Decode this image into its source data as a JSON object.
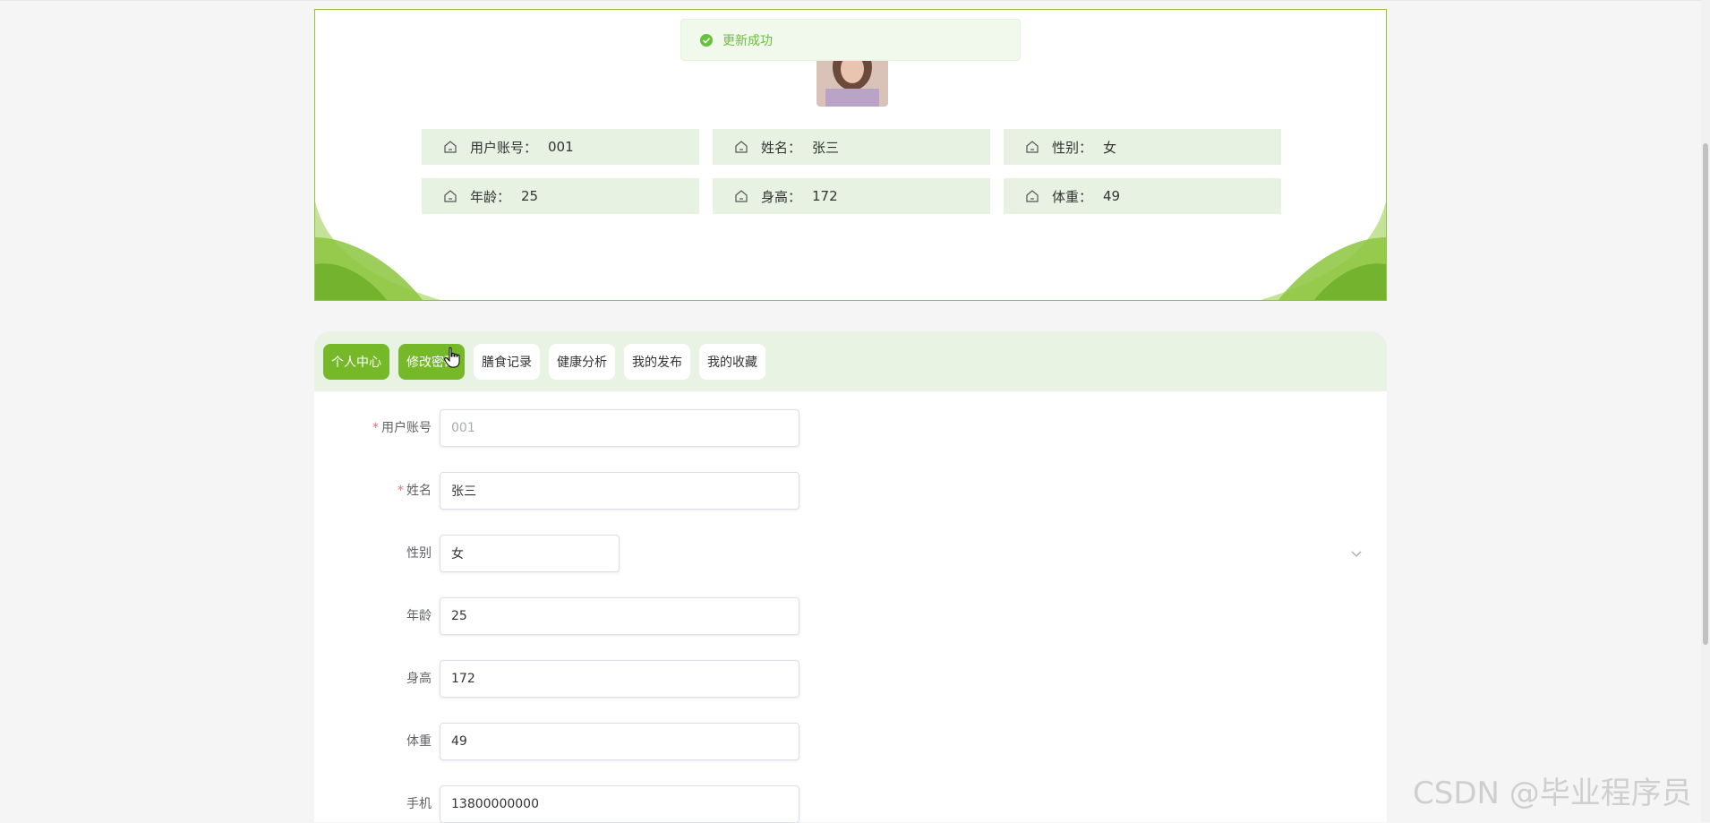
{
  "toast": {
    "message": "更新成功",
    "icon": "check-circle-icon",
    "color": "#67c23a"
  },
  "profile": {
    "avatar": "user-avatar-photo",
    "fields": [
      {
        "label": "用户账号：",
        "value": "001",
        "icon": "home-icon"
      },
      {
        "label": "姓名：",
        "value": "张三",
        "icon": "home-icon"
      },
      {
        "label": "性别：",
        "value": "女",
        "icon": "home-icon"
      },
      {
        "label": "年龄：",
        "value": "25",
        "icon": "home-icon"
      },
      {
        "label": "身高：",
        "value": "172",
        "icon": "home-icon"
      },
      {
        "label": "体重：",
        "value": "49",
        "icon": "home-icon"
      }
    ]
  },
  "tabs": [
    {
      "label": "个人中心",
      "active": true
    },
    {
      "label": "修改密码",
      "active": true
    },
    {
      "label": "膳食记录",
      "active": false
    },
    {
      "label": "健康分析",
      "active": false
    },
    {
      "label": "我的发布",
      "active": false
    },
    {
      "label": "我的收藏",
      "active": false
    }
  ],
  "form": {
    "fields": [
      {
        "label": "用户账号",
        "required": true,
        "value": "001",
        "readonly": true
      },
      {
        "label": "姓名",
        "required": true,
        "value": "张三"
      },
      {
        "label": "性别",
        "required": false,
        "value": "女",
        "type": "select"
      },
      {
        "label": "年龄",
        "required": false,
        "value": "25"
      },
      {
        "label": "身高",
        "required": false,
        "value": "172"
      },
      {
        "label": "体重",
        "required": false,
        "value": "49"
      },
      {
        "label": "手机",
        "required": false,
        "value": "13800000000"
      }
    ],
    "required_mark": "*"
  },
  "watermark": "CSDN @毕业程序员",
  "colors": {
    "accent": "#75b928",
    "border": "#8fc23a",
    "info_bg": "#e7f2e3",
    "tabs_bg": "#e8f3e4"
  }
}
